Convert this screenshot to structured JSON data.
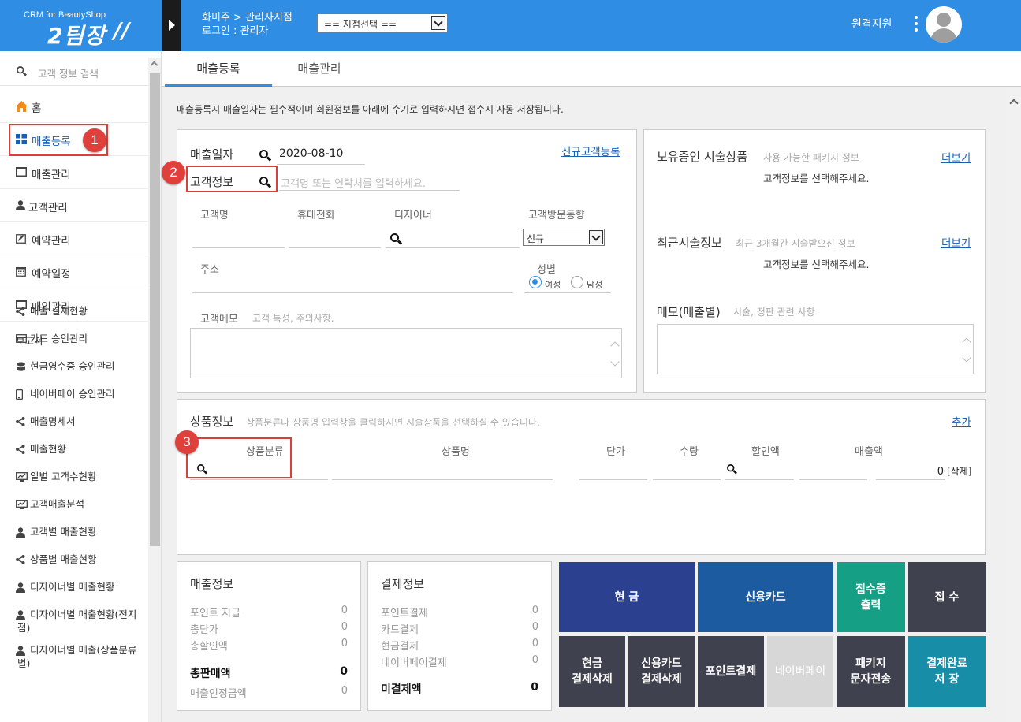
{
  "header": {
    "logo_small": "CRM for BeautyShop",
    "logo_big": "2팀장",
    "breadcrumb": "화미주 > 관리자지점",
    "login": "로그인 : 관리자",
    "branch_select": "== 지점선택 ==",
    "remote_support": "원격지원"
  },
  "sidebar": {
    "search_placeholder": "고객 정보 검색",
    "nav": [
      {
        "label": "홈"
      },
      {
        "label": "매출등록"
      },
      {
        "label": "매출관리"
      },
      {
        "label": "고객관리"
      },
      {
        "label": "예약관리"
      },
      {
        "label": "예약일정"
      },
      {
        "label": "매입관리"
      }
    ],
    "report_header": "보고서",
    "reports": [
      {
        "label": "매출 결제현황"
      },
      {
        "label": "카드 승인관리"
      },
      {
        "label": "현금영수증 승인관리"
      },
      {
        "label": "네이버페이 승인관리"
      },
      {
        "label": "매출명세서"
      },
      {
        "label": "매출현황"
      },
      {
        "label": "일별 고객수현황"
      },
      {
        "label": "고객매출분석"
      },
      {
        "label": "고객별 매출현황"
      },
      {
        "label": "상품별 매출현황"
      },
      {
        "label": "디자이너별 매출현황"
      },
      {
        "label": "디자이너별 매출현황(전지점)"
      },
      {
        "label": "디자이너별 매출(상품분류별)"
      }
    ]
  },
  "tabs": [
    {
      "label": "매출등록"
    },
    {
      "label": "매출관리"
    }
  ],
  "notice": "매출등록시 매출일자는 필수적이며 회원정보를 아래에 수기로 입력하시면 접수시 자동 저장됩니다.",
  "customer": {
    "sales_date_label": "매출일자",
    "sales_date_value": "2020-08-10",
    "new_customer_link": "신규고객등록",
    "info_label": "고객정보",
    "info_placeholder": "고객명 또는 연락처를 입력하세요.",
    "name_label": "고객명",
    "phone_label": "휴대전화",
    "designer_label": "디자이너",
    "visit_label": "고객방문동향",
    "visit_value": "신규",
    "address_label": "주소",
    "gender_label": "성별",
    "female": "여성",
    "male": "남성",
    "memo_label": "고객메모",
    "memo_placeholder": "고객 특성, 주의사항."
  },
  "right": {
    "pkg_title": "보유중인 시술상품",
    "pkg_hint": "사용 가능한 패키지 정보",
    "more": "더보기",
    "select_customer": "고객정보를 선택해주세요.",
    "recent_title": "최근시술정보",
    "recent_hint": "최근 3개월간 시술받으신 정보",
    "memo_title": "메모(매출별)",
    "memo_hint": "시술, 정판 관련 사항"
  },
  "product": {
    "title": "상품정보",
    "hint": "상품분류나 상품명 입력창을 클릭하시면 시술상품을 선택하실 수 있습니다.",
    "add": "추가",
    "columns": [
      "상품분류",
      "상품명",
      "단가",
      "수량",
      "할인액",
      "매출액"
    ],
    "amount": "0",
    "delete": "[삭제]"
  },
  "sales_info": {
    "title": "매출정보",
    "rows": [
      {
        "label": "포인트 지급",
        "value": "0"
      },
      {
        "label": "총단가",
        "value": "0"
      },
      {
        "label": "총할인액",
        "value": "0"
      }
    ],
    "total_label": "총판매액",
    "total_value": "0",
    "confirmed_label": "매출인정금액",
    "confirmed_value": "0"
  },
  "payment_info": {
    "title": "결제정보",
    "rows": [
      {
        "label": "포인트결제",
        "value": "0"
      },
      {
        "label": "카드결제",
        "value": "0"
      },
      {
        "label": "현금결제",
        "value": "0"
      },
      {
        "label": "네이버페이결제",
        "value": "0"
      }
    ],
    "unpaid_label": "미결제액",
    "unpaid_value": "0"
  },
  "buttons": {
    "cash": "현 금",
    "card": "신용카드",
    "receipt_1": "접수증",
    "receipt_2": "출력",
    "accept": "접 수",
    "cash_del_1": "현금",
    "cash_del_2": "결제삭제",
    "card_del_1": "신용카드",
    "card_del_2": "결제삭제",
    "point": "포인트결제",
    "naver": "네이버페이",
    "pkg_sms_1": "패키지",
    "pkg_sms_2": "문자전송",
    "save_1": "결제완료",
    "save_2": "저 장"
  },
  "badges": [
    "1",
    "2",
    "3"
  ],
  "colors": {
    "header": "#2f8de4",
    "cash": "#2b4190",
    "card": "#1c5ba0",
    "receipt": "#15a085",
    "dark": "#3f414f",
    "naver": "#d7d7d7",
    "save": "#188da8",
    "badge": "#e0403c"
  }
}
